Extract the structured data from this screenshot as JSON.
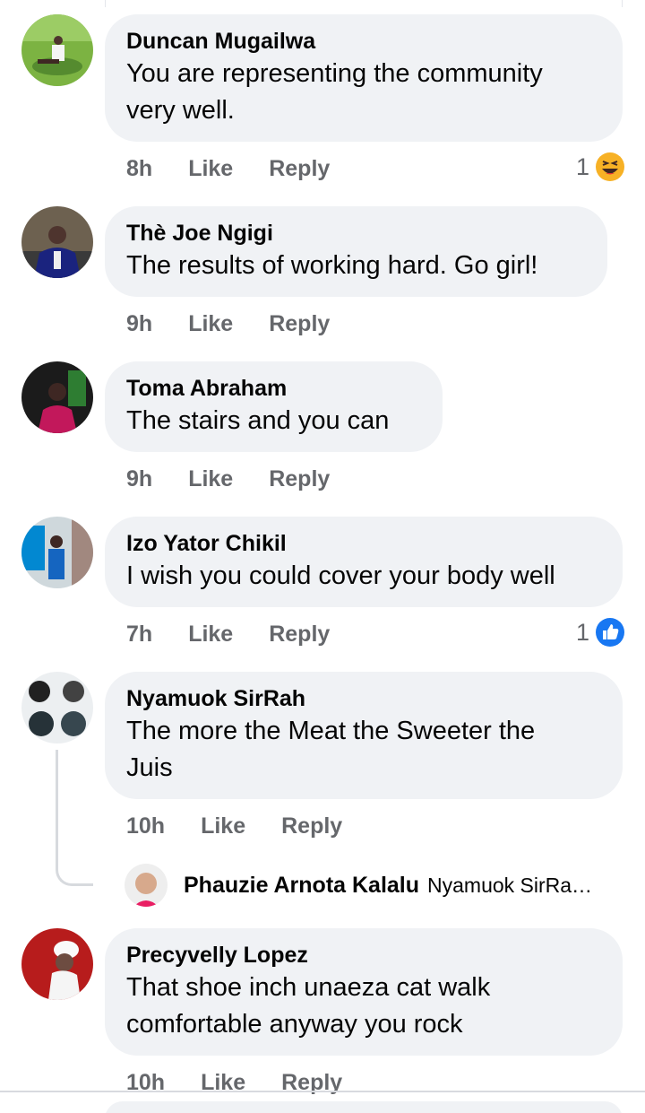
{
  "comments": [
    {
      "author": "Duncan Mugailwa",
      "lines": [
        "You are representing the community",
        "very well."
      ],
      "time": "8h",
      "like": "Like",
      "reply": "Reply",
      "reaction_count": "1",
      "reaction_icon": "haha-icon",
      "avatar_icon": "avatar-photo"
    },
    {
      "author": "Thè Joe Ngigi",
      "lines": [
        "The results of working hard. Go girl!"
      ],
      "time": "9h",
      "like": "Like",
      "reply": "Reply",
      "avatar_icon": "avatar-photo"
    },
    {
      "author": "Toma Abraham",
      "lines": [
        "The stairs and you can"
      ],
      "time": "9h",
      "like": "Like",
      "reply": "Reply",
      "avatar_icon": "avatar-photo"
    },
    {
      "author": "Izo Yator Chikil",
      "lines": [
        "I wish you could cover your body well"
      ],
      "time": "7h",
      "like": "Like",
      "reply": "Reply",
      "reaction_count": "1",
      "reaction_icon": "like-icon",
      "avatar_icon": "avatar-photo"
    },
    {
      "author": "Nyamuok SirRah",
      "lines": [
        "The more the Meat the Sweeter the",
        "Juis"
      ],
      "time": "10h",
      "like": "Like",
      "reply": "Reply",
      "avatar_icon": "avatar-photo"
    },
    {
      "author": "Precyvelly Lopez",
      "lines": [
        "That shoe inch  unaeza cat walk",
        "comfortable  anyway you rock"
      ],
      "time": "10h",
      "like": "Like",
      "reply": "Reply",
      "avatar_icon": "avatar-photo"
    }
  ],
  "reply_preview": {
    "author": "Phauzie Arnota Kalalu",
    "snippet": "Nyamuok SirRa…",
    "avatar_icon": "avatar-photo"
  },
  "colors": {
    "bubble": "#f0f2f5",
    "meta_text": "#65676b",
    "like_blue": "#1877f2",
    "haha_yellow": "#f7b125"
  }
}
